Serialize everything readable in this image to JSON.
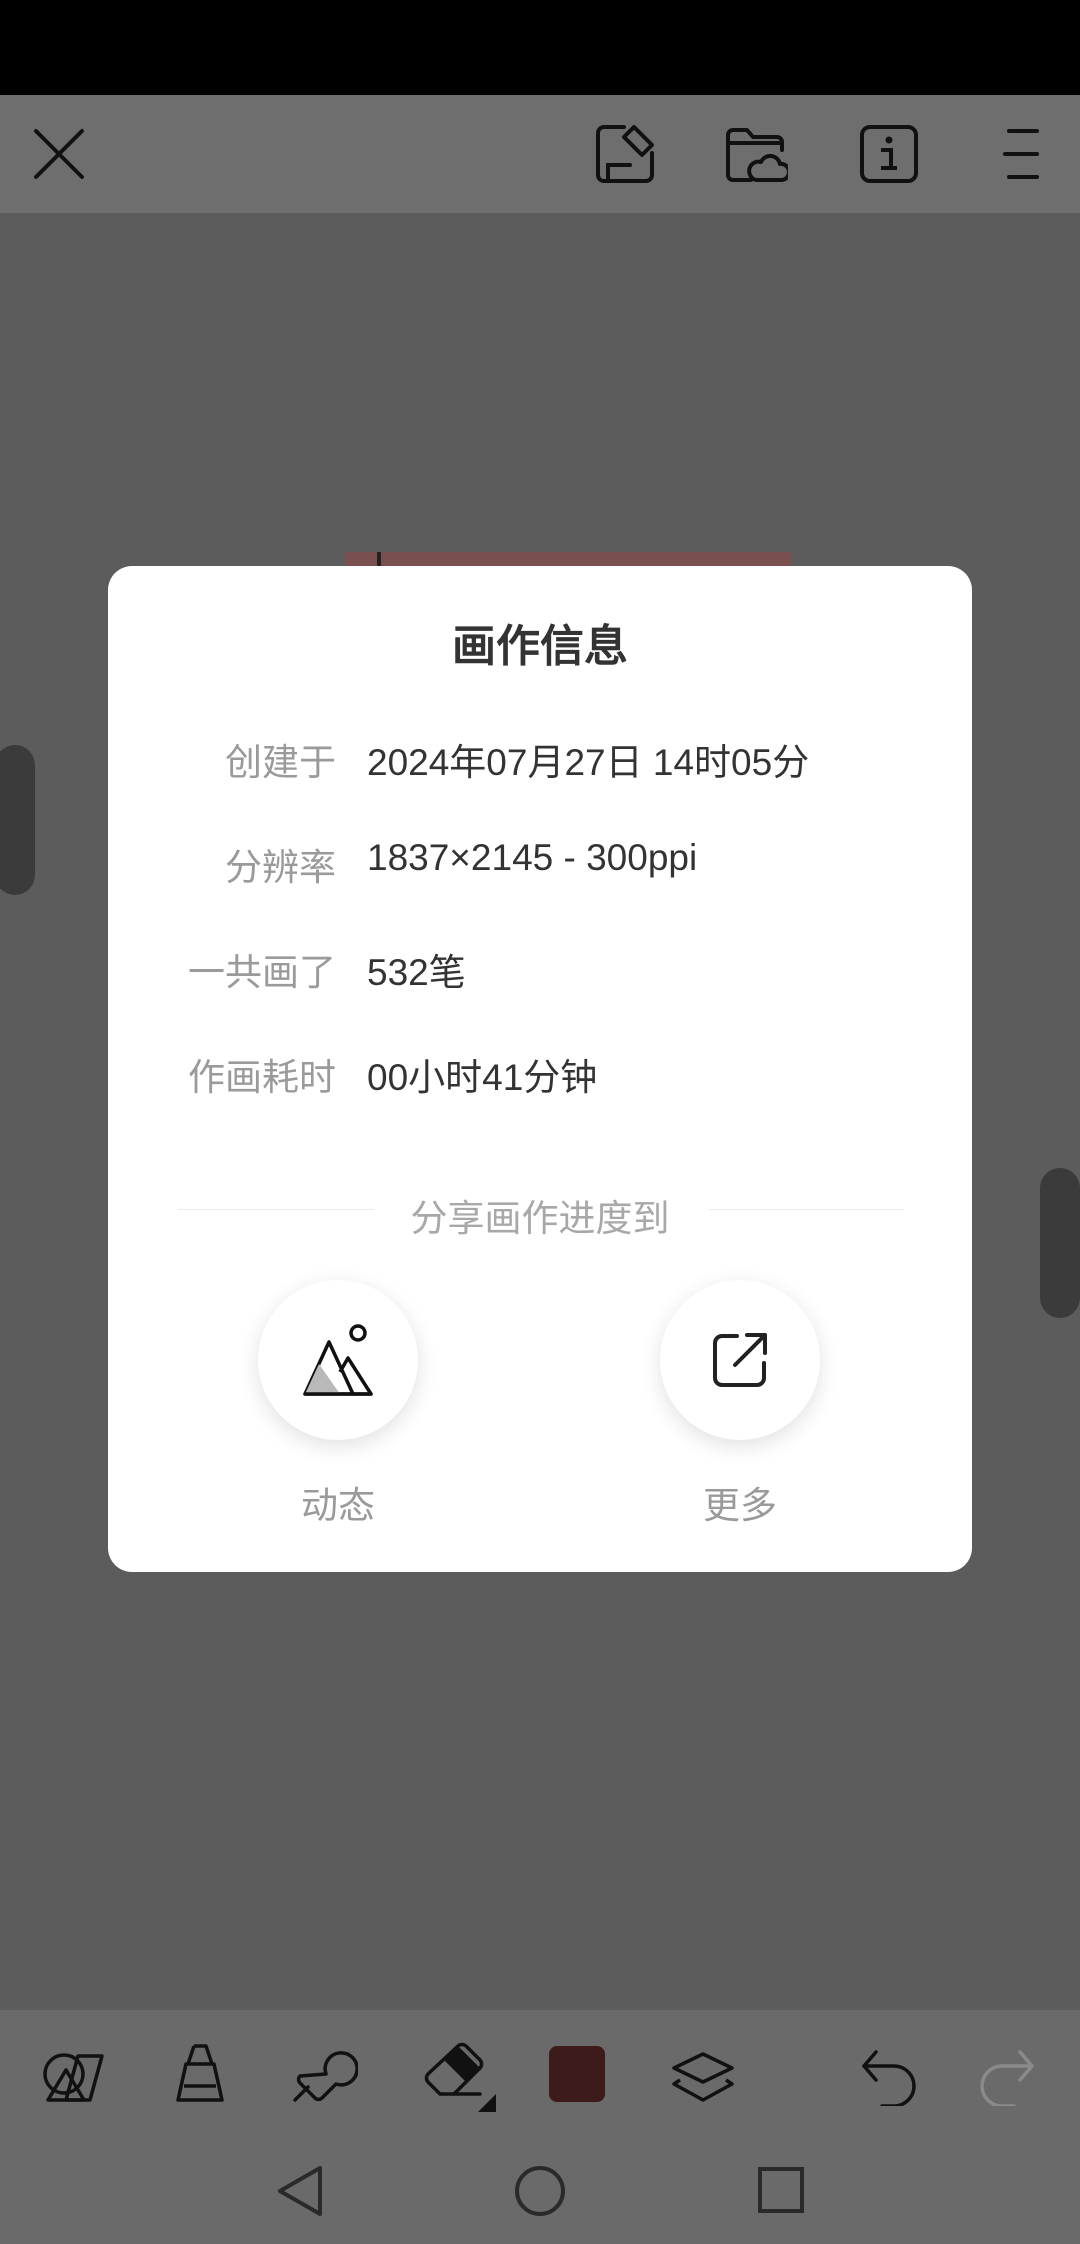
{
  "dialog": {
    "title": "画作信息",
    "rows": [
      {
        "label": "创建于",
        "value": "2024年07月27日 14时05分"
      },
      {
        "label": "分辨率",
        "value": "1837×2145 - 300ppi"
      },
      {
        "label": "一共画了",
        "value": "532笔"
      },
      {
        "label": "作画耗时",
        "value": "00小时41分钟"
      }
    ],
    "share_title": "分享画作进度到",
    "share_buttons": [
      {
        "label": "动态",
        "icon": "mountain-image-icon"
      },
      {
        "label": "更多",
        "icon": "external-share-icon"
      }
    ]
  },
  "top_bar": {
    "icons": [
      "close-icon",
      "save-icon",
      "cloud-folder-icon",
      "info-icon",
      "menu-icon"
    ]
  },
  "toolbar": {
    "icons": [
      "shapes-icon",
      "paint-bucket-icon",
      "brush-icon",
      "eraser-icon",
      "color-swatch",
      "layers-icon",
      "undo-icon",
      "redo-icon"
    ],
    "current_color": "#3d1b1b"
  },
  "nav": {
    "icons": [
      "back-icon",
      "home-icon",
      "recents-icon"
    ]
  }
}
